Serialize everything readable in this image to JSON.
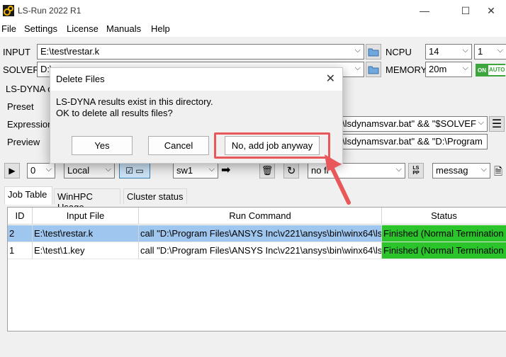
{
  "window": {
    "title": "LS-Run 2022 R1",
    "controls": {
      "minimize": "—",
      "maximize": "☐",
      "close": "✕"
    }
  },
  "menu": [
    "File",
    "Settings",
    "License",
    "Manuals",
    "Help"
  ],
  "input": {
    "label": "INPUT",
    "value": "E:\\test\\restar.k"
  },
  "solver": {
    "label": "SOLVER",
    "value_visible": "D:\\"
  },
  "ncpu": {
    "label": "NCPU",
    "value": "14",
    "value2": "1"
  },
  "memory": {
    "label": "MEMORY",
    "value": "20m",
    "toggle_on": "ON",
    "toggle_auto": "AUTO"
  },
  "section": {
    "label": "LS-DYNA o"
  },
  "preset": {
    "label": "Preset"
  },
  "expression": {
    "label": "Expression",
    "value_tail": "\\lsdynamsvar.bat\" && \"$SOLVEF"
  },
  "preview": {
    "label": "Preview",
    "value_tail": "\\lsdynamsvar.bat\" && \"D:\\Program"
  },
  "toolbar": {
    "count": "0",
    "local": "Local",
    "sw": "sw1",
    "filter": "no fi",
    "messag": "messag"
  },
  "tabs": [
    "Job Table",
    "WinHPC Usage",
    "Cluster status"
  ],
  "table": {
    "headers": [
      "ID",
      "Input File",
      "Run Command",
      "Status"
    ],
    "rows": [
      {
        "id": "2",
        "input": "E:\\test\\restar.k",
        "cmd": "call \"D:\\Program Files\\ANSYS Inc\\v221\\ansys\\bin\\winx64\\ls",
        "status": "Finished (Normal Termination"
      },
      {
        "id": "1",
        "input": "E:\\test\\1.key",
        "cmd": "call \"D:\\Program Files\\ANSYS Inc\\v221\\ansys\\bin\\winx64\\ls",
        "status": "Finished (Normal Termination"
      }
    ]
  },
  "dialog": {
    "title": "Delete Files",
    "line1": "LS-DYNA results exist in this directory.",
    "line2": "OK to delete all results files?",
    "yes": "Yes",
    "cancel": "Cancel",
    "no_add": "No, add job anyway"
  },
  "colors": {
    "highlight": "#e8575a",
    "finished": "#2bc42b",
    "selected": "#9fc6ee",
    "toggle": "#3ca53c"
  }
}
